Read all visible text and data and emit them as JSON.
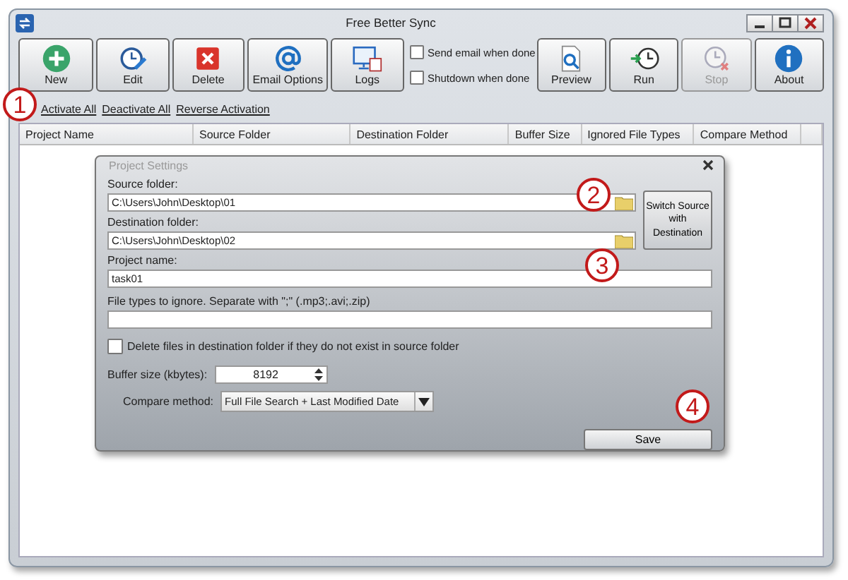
{
  "window": {
    "title": "Free Better Sync"
  },
  "toolbar": {
    "buttons": [
      {
        "label": "New",
        "disabled": false
      },
      {
        "label": "Edit",
        "disabled": false
      },
      {
        "label": "Delete",
        "disabled": false
      },
      {
        "label": "Email Options",
        "disabled": false
      },
      {
        "label": "Logs",
        "disabled": false
      },
      {
        "label": "Preview",
        "disabled": false
      },
      {
        "label": "Run",
        "disabled": false
      },
      {
        "label": "Stop",
        "disabled": true
      },
      {
        "label": "About",
        "disabled": false
      }
    ],
    "options": [
      {
        "label": "Send email when done",
        "checked": false
      },
      {
        "label": "Shutdown when done",
        "checked": false
      }
    ]
  },
  "links": [
    "Activate All",
    "Deactivate All",
    "Reverse Activation"
  ],
  "table": {
    "columns": [
      "Project Name",
      "Source Folder",
      "Destination Folder",
      "Buffer Size",
      "Ignored File Types",
      "Compare Method"
    ]
  },
  "dialog": {
    "title": "Project Settings",
    "source_label": "Source folder:",
    "source_value": "C:\\Users\\John\\Desktop\\01",
    "destination_label": "Destination folder:",
    "destination_value": "C:\\Users\\John\\Desktop\\02",
    "switch_button": "Switch Source with Destination",
    "project_label": "Project name:",
    "project_value": "task01",
    "ignore_label": "File types to ignore. Separate with \";\" (.mp3;.avi;.zip)",
    "delete_option": {
      "label": "Delete files in destination folder if they do not exist in source folder",
      "checked": false
    },
    "buffer_label": "Buffer size (kbytes):",
    "buffer_value": "8192",
    "compare_label": "Compare method:",
    "compare_value": "Full File Search + Last Modified Date",
    "save_button": "Save"
  },
  "callouts": [
    "1",
    "2",
    "3",
    "4"
  ]
}
